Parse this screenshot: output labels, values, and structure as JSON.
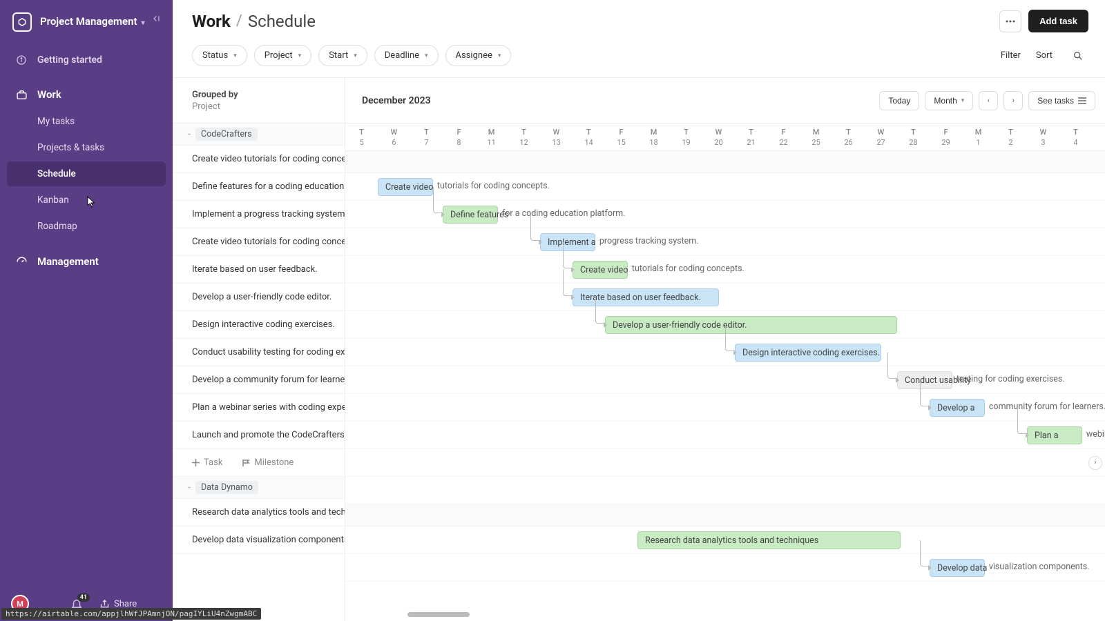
{
  "workspace": {
    "name": "Project Management"
  },
  "sidebar": {
    "items": [
      {
        "label": "Getting started"
      },
      {
        "label": "Work"
      },
      {
        "label": "My tasks"
      },
      {
        "label": "Projects & tasks"
      },
      {
        "label": "Schedule"
      },
      {
        "label": "Kanban"
      },
      {
        "label": "Roadmap"
      },
      {
        "label": "Management"
      }
    ],
    "share_label": "Share",
    "notif_count": "41",
    "avatar_initial": "M"
  },
  "breadcrumb": {
    "root": "Work",
    "leaf": "Schedule"
  },
  "topbar": {
    "add_task_label": "Add task"
  },
  "filters": {
    "pills": [
      "Status",
      "Project",
      "Start",
      "Deadline",
      "Assignee"
    ],
    "filter_label": "Filter",
    "sort_label": "Sort"
  },
  "grouped": {
    "label": "Grouped by",
    "value": "Project"
  },
  "timeline_header": {
    "month": "December 2023",
    "today_label": "Today",
    "range_label": "Month",
    "see_tasks_label": "See tasks"
  },
  "columns": [
    {
      "dow": "T",
      "num": "5"
    },
    {
      "dow": "W",
      "num": "6"
    },
    {
      "dow": "T",
      "num": "7"
    },
    {
      "dow": "F",
      "num": "8"
    },
    {
      "dow": "M",
      "num": "11"
    },
    {
      "dow": "T",
      "num": "12"
    },
    {
      "dow": "W",
      "num": "13"
    },
    {
      "dow": "T",
      "num": "14"
    },
    {
      "dow": "F",
      "num": "15"
    },
    {
      "dow": "M",
      "num": "18"
    },
    {
      "dow": "T",
      "num": "19"
    },
    {
      "dow": "W",
      "num": "20"
    },
    {
      "dow": "T",
      "num": "21"
    },
    {
      "dow": "F",
      "num": "22"
    },
    {
      "dow": "M",
      "num": "25"
    },
    {
      "dow": "T",
      "num": "26"
    },
    {
      "dow": "W",
      "num": "27"
    },
    {
      "dow": "T",
      "num": "28"
    },
    {
      "dow": "F",
      "num": "29"
    },
    {
      "dow": "M",
      "num": "1"
    },
    {
      "dow": "T",
      "num": "2"
    },
    {
      "dow": "W",
      "num": "3"
    },
    {
      "dow": "T",
      "num": "4"
    }
  ],
  "groups": [
    {
      "name": "CodeCrafters",
      "tasks": [
        {
          "label": "Create video tutorials for coding concepts.",
          "bar": {
            "start": 1,
            "span": 5,
            "color": "blue"
          }
        },
        {
          "label": "Define features for a coding education platform.",
          "bar": {
            "start": 3,
            "span": 6,
            "color": "green"
          }
        },
        {
          "label": "Implement a progress tracking system.",
          "bar": {
            "start": 6,
            "span": 5,
            "color": "blue"
          }
        },
        {
          "label": "Create video tutorials for coding concepts.",
          "bar": {
            "start": 7,
            "span": 6,
            "color": "green"
          }
        },
        {
          "label": "Iterate based on user feedback.",
          "bar": {
            "start": 7,
            "span": 5,
            "color": "blue",
            "filled": true
          }
        },
        {
          "label": "Develop a user-friendly code editor.",
          "bar": {
            "start": 8,
            "span": 10,
            "color": "green",
            "filled": true
          }
        },
        {
          "label": "Design interactive coding exercises.",
          "bar": {
            "start": 12,
            "span": 5,
            "color": "blue",
            "filled": true
          }
        },
        {
          "label": "Conduct usability testing for coding exercises.",
          "bar": {
            "start": 17,
            "span": 6,
            "color": "gray"
          }
        },
        {
          "label": "Develop a community forum for learners.",
          "bar": {
            "start": 18,
            "span": 5,
            "color": "blue"
          }
        },
        {
          "label": "Plan a webinar series with coding experts.",
          "bar": {
            "start": 21,
            "span": 3,
            "color": "green"
          }
        },
        {
          "label": "Launch and promote the CodeCrafters platform."
        }
      ],
      "add_task_label": "Task",
      "add_milestone_label": "Milestone"
    },
    {
      "name": "Data Dynamo",
      "tasks": [
        {
          "label": "Research data analytics tools and techniques",
          "bar": {
            "start": 9,
            "span": 9,
            "color": "green",
            "filled": true
          }
        },
        {
          "label": "Develop data visualization components.",
          "bar": {
            "start": 18,
            "span": 5,
            "color": "blue"
          }
        }
      ]
    }
  ],
  "status_url": "https://airtable.com/appjlhWfJPAmnjON/pagIYLiU4nZwgmABC"
}
